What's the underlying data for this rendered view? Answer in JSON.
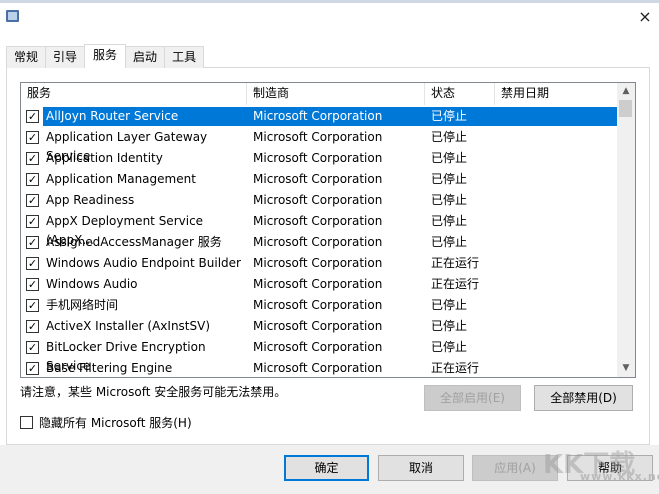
{
  "window": {
    "close_icon": "×"
  },
  "tabs": [
    {
      "label": "常规"
    },
    {
      "label": "引导"
    },
    {
      "label": "服务"
    },
    {
      "label": "启动"
    },
    {
      "label": "工具"
    }
  ],
  "active_tab": "服务",
  "columns": [
    "服务",
    "制造商",
    "状态",
    "禁用日期"
  ],
  "services": [
    {
      "name": "AllJoyn Router Service",
      "vendor": "Microsoft Corporation",
      "status": "已停止",
      "date": "",
      "checked": true,
      "selected": true
    },
    {
      "name": "Application Layer Gateway Service",
      "vendor": "Microsoft Corporation",
      "status": "已停止",
      "date": "",
      "checked": true
    },
    {
      "name": "Application Identity",
      "vendor": "Microsoft Corporation",
      "status": "已停止",
      "date": "",
      "checked": true
    },
    {
      "name": "Application Management",
      "vendor": "Microsoft Corporation",
      "status": "已停止",
      "date": "",
      "checked": true
    },
    {
      "name": "App Readiness",
      "vendor": "Microsoft Corporation",
      "status": "已停止",
      "date": "",
      "checked": true
    },
    {
      "name": "AppX Deployment Service (AppX...",
      "vendor": "Microsoft Corporation",
      "status": "已停止",
      "date": "",
      "checked": true
    },
    {
      "name": "AssignedAccessManager 服务",
      "vendor": "Microsoft Corporation",
      "status": "已停止",
      "date": "",
      "checked": true
    },
    {
      "name": "Windows Audio Endpoint Builder",
      "vendor": "Microsoft Corporation",
      "status": "正在运行",
      "date": "",
      "checked": true
    },
    {
      "name": "Windows Audio",
      "vendor": "Microsoft Corporation",
      "status": "正在运行",
      "date": "",
      "checked": true
    },
    {
      "name": "手机网络时间",
      "vendor": "Microsoft Corporation",
      "status": "已停止",
      "date": "",
      "checked": true
    },
    {
      "name": "ActiveX Installer (AxInstSV)",
      "vendor": "Microsoft Corporation",
      "status": "已停止",
      "date": "",
      "checked": true
    },
    {
      "name": "BitLocker Drive Encryption Service",
      "vendor": "Microsoft Corporation",
      "status": "已停止",
      "date": "",
      "checked": true
    },
    {
      "name": "Base Filtering Engine",
      "vendor": "Microsoft Corporation",
      "status": "正在运行",
      "date": "",
      "checked": true
    }
  ],
  "note": "请注意，某些 Microsoft 安全服务可能无法禁用。",
  "enable_all": "全部启用(E)",
  "disable_all": "全部禁用(D)",
  "hide_ms": "隐藏所有 Microsoft 服务(H)",
  "buttons": {
    "ok": "确定",
    "cancel": "取消",
    "apply": "应用(A)",
    "help": "帮助"
  },
  "watermark": {
    "logo": "KK下载",
    "url": "www.kkx.net"
  }
}
